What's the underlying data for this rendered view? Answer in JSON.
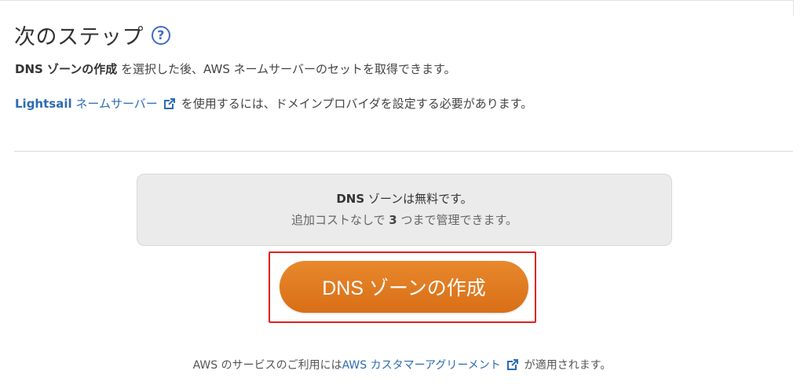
{
  "heading": {
    "title": "次のステップ",
    "help_glyph": "?"
  },
  "line1": {
    "bold": "DNS ゾーンの作成",
    "rest": " を選択した後、AWS ネームサーバーのセットを取得できます。"
  },
  "line2": {
    "link_bold": "Lightsail",
    "link_rest": " ネームサーバー",
    "rest": "を使用するには、ドメインプロバイダを設定する必要があります。"
  },
  "info_box": {
    "title_bold": "DNS",
    "title_rest": " ゾーンは無料です。",
    "sub_pre": "追加コストなしで ",
    "sub_num": "3",
    "sub_post": " つまで管理できます。"
  },
  "create_button": {
    "label": "DNS ゾーンの作成"
  },
  "footer": {
    "pre": "AWS のサービスのご利用には ",
    "link": "AWS カスタマーアグリーメント",
    "post": "が適用されます。"
  },
  "colors": {
    "accent_orange": "#e07b22",
    "link_blue": "#2d6bb3",
    "highlight_red": "#e02020"
  },
  "icons": {
    "help": "help-circle-icon",
    "external": "external-link-icon"
  }
}
